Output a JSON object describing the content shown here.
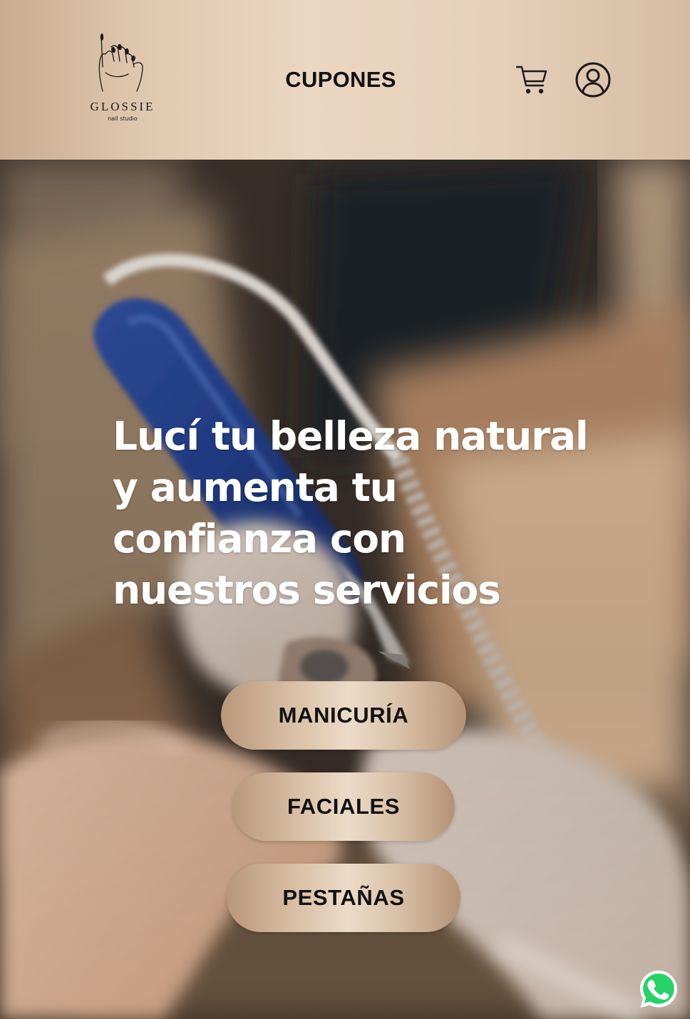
{
  "header": {
    "brand_name": "GLOSSIE",
    "brand_subtitle": "nail studio",
    "nav_cupones": "CUPONES",
    "cart_icon": "cart-icon",
    "user_icon": "user-account-icon"
  },
  "hero": {
    "headline": "Lucí tu belleza natural y aumenta tu confianza con nuestros servicios",
    "background": "photo-manicure-nail-drill",
    "buttons": [
      {
        "label": "MANICURÍA"
      },
      {
        "label": "FACIALES"
      },
      {
        "label": "PESTAÑAS"
      }
    ],
    "whatsapp_icon": "whatsapp-icon"
  },
  "colors": {
    "header_gradient_light": "#ebd6c1",
    "header_gradient_dark": "#c9ac90",
    "button_gold": "#d9c0a6",
    "text_dark": "#111111",
    "headline_white": "#ffffff",
    "whatsapp_green": "#25d366"
  }
}
